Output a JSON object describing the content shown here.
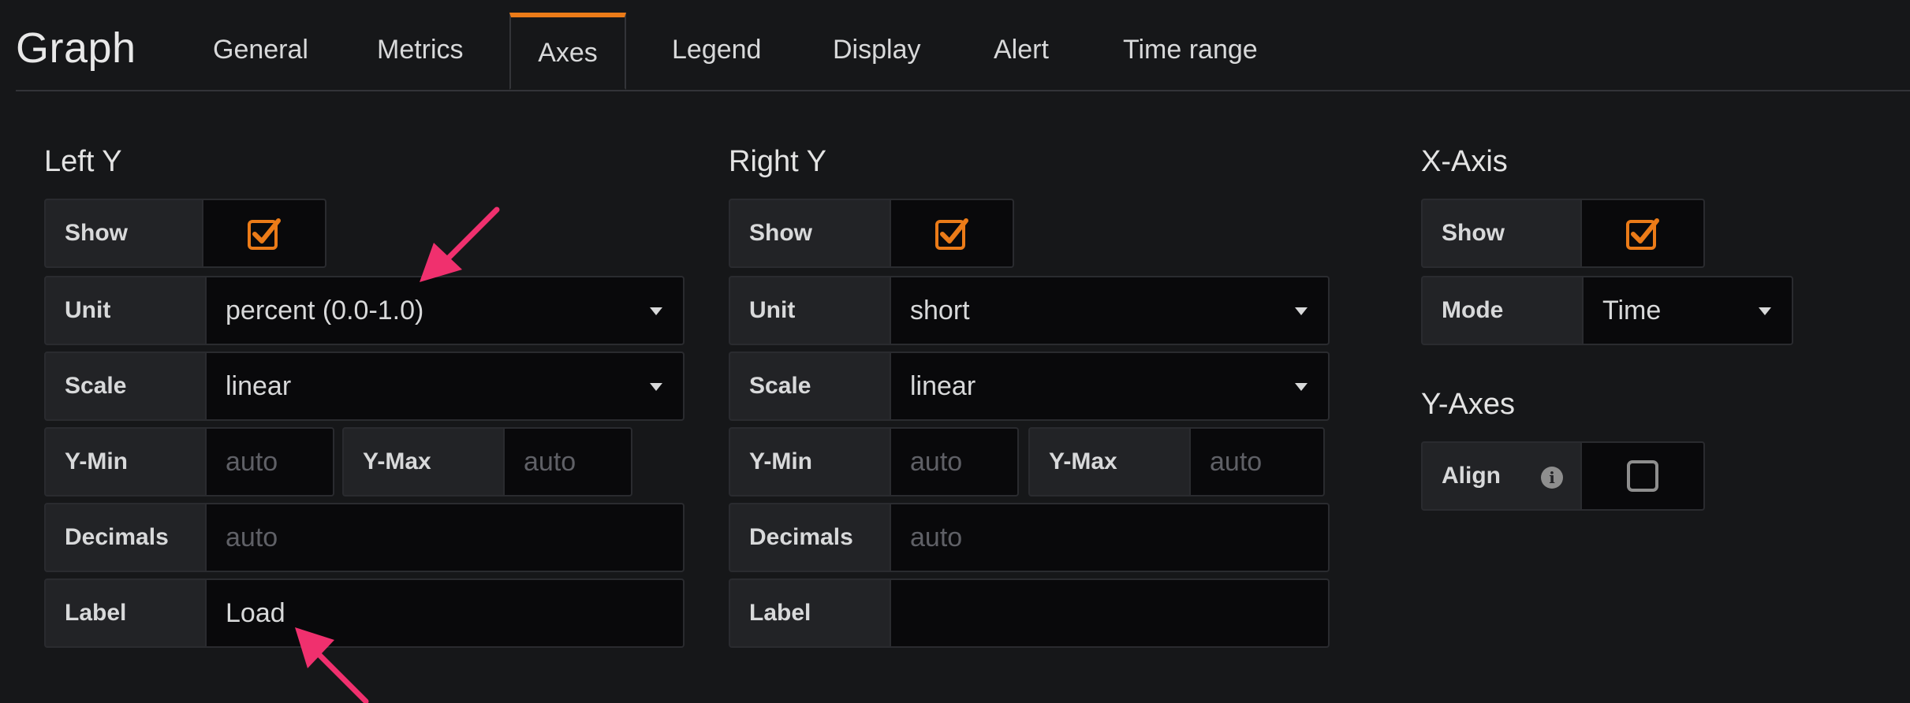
{
  "header": {
    "title": "Graph",
    "tabs": [
      {
        "label": "General"
      },
      {
        "label": "Metrics"
      },
      {
        "label": "Axes"
      },
      {
        "label": "Legend"
      },
      {
        "label": "Display"
      },
      {
        "label": "Alert"
      },
      {
        "label": "Time range"
      }
    ],
    "active_tab": "Axes"
  },
  "left_y": {
    "title": "Left Y",
    "show_label": "Show",
    "show_checked": true,
    "unit_label": "Unit",
    "unit_value": "percent (0.0-1.0)",
    "scale_label": "Scale",
    "scale_value": "linear",
    "ymin_label": "Y-Min",
    "ymin_placeholder": "auto",
    "ymax_label": "Y-Max",
    "ymax_placeholder": "auto",
    "decimals_label": "Decimals",
    "decimals_placeholder": "auto",
    "label_label": "Label",
    "label_value": "Load"
  },
  "right_y": {
    "title": "Right Y",
    "show_label": "Show",
    "show_checked": true,
    "unit_label": "Unit",
    "unit_value": "short",
    "scale_label": "Scale",
    "scale_value": "linear",
    "ymin_label": "Y-Min",
    "ymin_placeholder": "auto",
    "ymax_label": "Y-Max",
    "ymax_placeholder": "auto",
    "decimals_label": "Decimals",
    "decimals_placeholder": "auto",
    "label_label": "Label",
    "label_value": ""
  },
  "x_axis": {
    "title": "X-Axis",
    "show_label": "Show",
    "show_checked": true,
    "mode_label": "Mode",
    "mode_value": "Time"
  },
  "y_axes": {
    "title": "Y-Axes",
    "align_label": "Align",
    "align_checked": false,
    "info_icon": "i"
  },
  "colors": {
    "accent": "#eb7b18",
    "annotation_arrow": "#f0306e"
  }
}
